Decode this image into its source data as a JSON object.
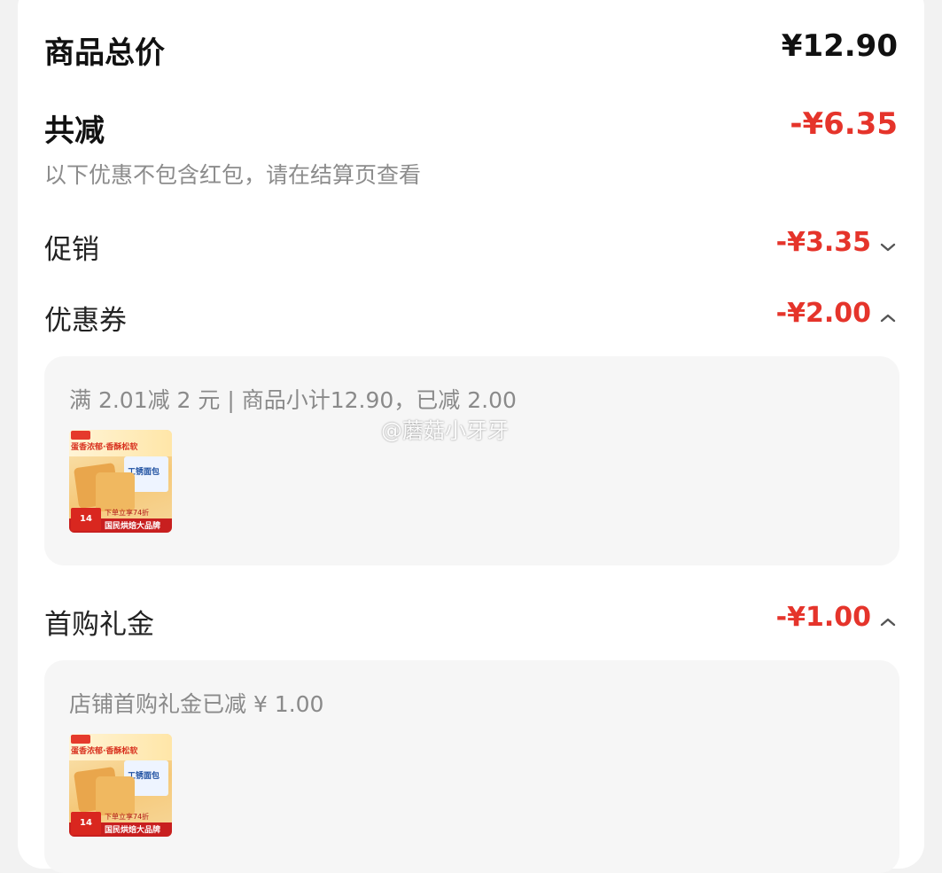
{
  "total": {
    "label": "商品总价",
    "value": "¥12.90"
  },
  "reduction": {
    "label": "共减",
    "value": "-¥6.35",
    "note": "以下优惠不包含红包，请在结算页查看"
  },
  "promo": {
    "label": "促销",
    "value": "-¥3.35",
    "icon": "chevron-down-icon"
  },
  "coupon": {
    "label": "优惠券",
    "value": "-¥2.00",
    "icon": "chevron-up-icon",
    "detail": "满 2.01减 2 元 | 商品小计12.90，已减 2.00"
  },
  "first_purchase": {
    "label": "首购礼金",
    "value": "-¥1.00",
    "icon": "chevron-up-icon",
    "detail": "店铺首购礼金已减 ¥ 1.00"
  },
  "product": {
    "banner_title": "蛋香浓郁·香酥松软",
    "box_text": "工锈面包",
    "promo": "下单立享74折",
    "brand_strip": "国民烘焙大品牌",
    "date": "14"
  },
  "watermark": "@蘑菇小牙牙",
  "colors": {
    "accent": "#e5342b",
    "panel": "#f6f6f6",
    "text_muted": "#8a8a8a"
  }
}
